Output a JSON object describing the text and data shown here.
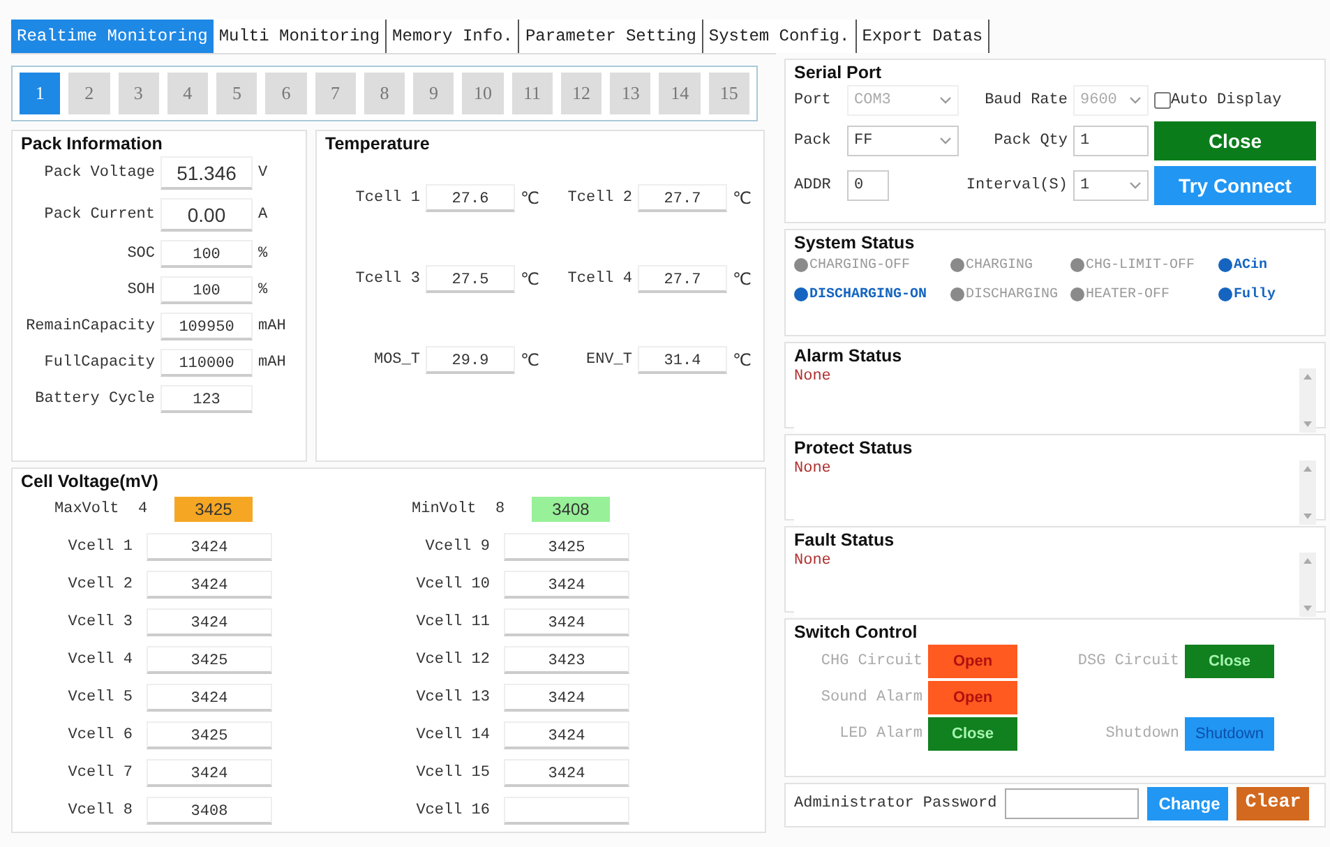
{
  "tabs": [
    {
      "label": "Realtime Monitoring",
      "selected": true
    },
    {
      "label": "Multi Monitoring",
      "selected": false
    },
    {
      "label": "Memory Info.",
      "selected": false
    },
    {
      "label": "Parameter Setting",
      "selected": false
    },
    {
      "label": "System Config.",
      "selected": false
    },
    {
      "label": "Export Datas",
      "selected": false
    }
  ],
  "packs": [
    {
      "label": "1",
      "selected": true
    },
    {
      "label": "2",
      "selected": false
    },
    {
      "label": "3",
      "selected": false
    },
    {
      "label": "4",
      "selected": false
    },
    {
      "label": "5",
      "selected": false
    },
    {
      "label": "6",
      "selected": false
    },
    {
      "label": "7",
      "selected": false
    },
    {
      "label": "8",
      "selected": false
    },
    {
      "label": "9",
      "selected": false
    },
    {
      "label": "10",
      "selected": false
    },
    {
      "label": "11",
      "selected": false
    },
    {
      "label": "12",
      "selected": false
    },
    {
      "label": "13",
      "selected": false
    },
    {
      "label": "14",
      "selected": false
    },
    {
      "label": "15",
      "selected": false
    }
  ],
  "pack_info": {
    "title": "Pack Information",
    "rows": [
      {
        "label": "Pack Voltage",
        "value": "51.346",
        "unit": "V",
        "kind": "large"
      },
      {
        "label": "Pack Current",
        "value": "0.00",
        "unit": "A",
        "kind": "large"
      },
      {
        "label": "SOC",
        "value": "100",
        "unit": "%",
        "kind": "normal"
      },
      {
        "label": "SOH",
        "value": "100",
        "unit": "%",
        "kind": "normal"
      },
      {
        "label": "RemainCapacity",
        "value": "109950",
        "unit": "mAH",
        "kind": "normal"
      },
      {
        "label": "FullCapacity",
        "value": "110000",
        "unit": "mAH",
        "kind": "normal"
      },
      {
        "label": "Battery Cycle",
        "value": "123",
        "kind": "normal"
      }
    ]
  },
  "temperature": {
    "title": "Temperature",
    "rows": [
      {
        "label": "Tcell 1",
        "value": "27.6",
        "unit": "℃"
      },
      {
        "label": "Tcell 2",
        "value": "27.7",
        "unit": "℃"
      },
      {
        "label": "Tcell 3",
        "value": "27.5",
        "unit": "℃"
      },
      {
        "label": "Tcell 4",
        "value": "27.7",
        "unit": "℃"
      },
      {
        "label": "MOS_T",
        "value": "29.9",
        "unit": "℃"
      },
      {
        "label": "ENV_T",
        "value": "31.4",
        "unit": "℃"
      }
    ]
  },
  "cell_voltage": {
    "title": "Cell Voltage(mV)",
    "extremes": [
      {
        "kind": "max",
        "label": "MaxVolt",
        "index": "4",
        "value": "3425"
      },
      {
        "kind": "min",
        "label": "MinVolt",
        "index": "8",
        "value": "3408"
      }
    ],
    "cells": [
      {
        "label": "Vcell 1",
        "value": "3424"
      },
      {
        "label": "Vcell 2",
        "value": "3424"
      },
      {
        "label": "Vcell 3",
        "value": "3424"
      },
      {
        "label": "Vcell 4",
        "value": "3425"
      },
      {
        "label": "Vcell 5",
        "value": "3424"
      },
      {
        "label": "Vcell 6",
        "value": "3425"
      },
      {
        "label": "Vcell 7",
        "value": "3424"
      },
      {
        "label": "Vcell 8",
        "value": "3408"
      },
      {
        "label": "Vcell 9",
        "value": "3425"
      },
      {
        "label": "Vcell 10",
        "value": "3424"
      },
      {
        "label": "Vcell 11",
        "value": "3424"
      },
      {
        "label": "Vcell 12",
        "value": "3423"
      },
      {
        "label": "Vcell 13",
        "value": "3424"
      },
      {
        "label": "Vcell 14",
        "value": "3424"
      },
      {
        "label": "Vcell 15",
        "value": "3424"
      },
      {
        "label": "Vcell 16"
      }
    ]
  },
  "serial_port": {
    "title": "Serial Port",
    "rows": [
      {
        "fields": [
          {
            "label": "Port",
            "value": "COM3",
            "kind": "select",
            "disabled": true
          },
          {
            "label": "Baud Rate",
            "value": "9600",
            "kind": "select",
            "disabled": true
          }
        ],
        "side": {
          "kind": "checkbox",
          "label": "Auto Display",
          "checked": false
        }
      },
      {
        "fields": [
          {
            "label": "Pack",
            "value": "FF",
            "kind": "select",
            "disabled": false
          },
          {
            "label": "Pack Qty",
            "value": "1",
            "kind": "input",
            "disabled": false
          }
        ],
        "side": {
          "kind": "close",
          "label": "Close"
        }
      },
      {
        "fields": [
          {
            "label": "ADDR",
            "value": "0",
            "kind": "short",
            "disabled": false
          },
          {
            "label": "Interval(S)",
            "value": "1",
            "kind": "select",
            "disabled": false
          }
        ],
        "side": {
          "kind": "connect",
          "label": "Try Connect"
        }
      }
    ]
  },
  "system_status": {
    "title": "System Status",
    "items": [
      {
        "label": "CHARGING-OFF",
        "on": false
      },
      {
        "label": "CHARGING",
        "on": false
      },
      {
        "label": "CHG-LIMIT-OFF",
        "on": false
      },
      {
        "label": "ACin",
        "on": true
      },
      {
        "label": "DISCHARGING-ON",
        "on": true
      },
      {
        "label": "DISCHARGING",
        "on": false
      },
      {
        "label": "HEATER-OFF",
        "on": false
      },
      {
        "label": "Fully",
        "on": true
      }
    ]
  },
  "status_boxes": [
    {
      "title": "Alarm Status",
      "text": "None"
    },
    {
      "title": "Protect Status",
      "text": "None"
    },
    {
      "title": "Fault Status",
      "text": "None"
    }
  ],
  "switch_control": {
    "title": "Switch Control",
    "rows": [
      {
        "left": {
          "label": "CHG Circuit",
          "action": "Open",
          "kind": "open"
        },
        "right": {
          "label": "DSG Circuit",
          "action": "Close",
          "kind": "close"
        }
      },
      {
        "left": {
          "label": "Sound Alarm",
          "action": "Open",
          "kind": "open"
        }
      },
      {
        "left": {
          "label": "LED Alarm",
          "action": "Close",
          "kind": "close"
        },
        "right": {
          "label": "Shutdown",
          "action": "Shutdown",
          "kind": "shutdown"
        }
      }
    ]
  },
  "password": {
    "label": "Administrator Password",
    "buttons": [
      {
        "label": "Change",
        "kind": "change"
      },
      {
        "label": "Clear",
        "kind": "clear"
      }
    ]
  }
}
